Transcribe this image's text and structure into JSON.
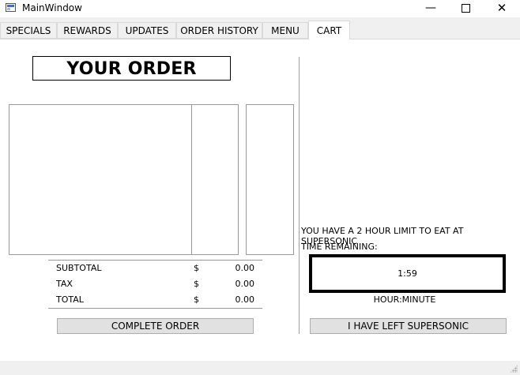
{
  "window": {
    "title": "MainWindow",
    "minimize_symbol": "—",
    "close_symbol": "✕"
  },
  "tabs": [
    {
      "label": "SPECIALS"
    },
    {
      "label": "REWARDS"
    },
    {
      "label": "UPDATES"
    },
    {
      "label": "ORDER HISTORY"
    },
    {
      "label": "MENU"
    },
    {
      "label": "CART",
      "active": true
    }
  ],
  "order": {
    "header": "YOUR ORDER",
    "totals": [
      {
        "label": "SUBTOTAL",
        "currency": "$",
        "value": "0.00"
      },
      {
        "label": "TAX",
        "currency": "$",
        "value": "0.00"
      },
      {
        "label": "TOTAL",
        "currency": "$",
        "value": "0.00"
      }
    ],
    "complete_button": "COMPLETE ORDER"
  },
  "timer": {
    "limit_text": "YOU HAVE A 2 HOUR LIMIT TO EAT AT SUPERSONIC",
    "remaining_label": "TIME REMAINING:",
    "value": "1:59",
    "format_label": "HOUR:MINUTE",
    "leave_button": "I HAVE LEFT SUPERSONIC"
  }
}
